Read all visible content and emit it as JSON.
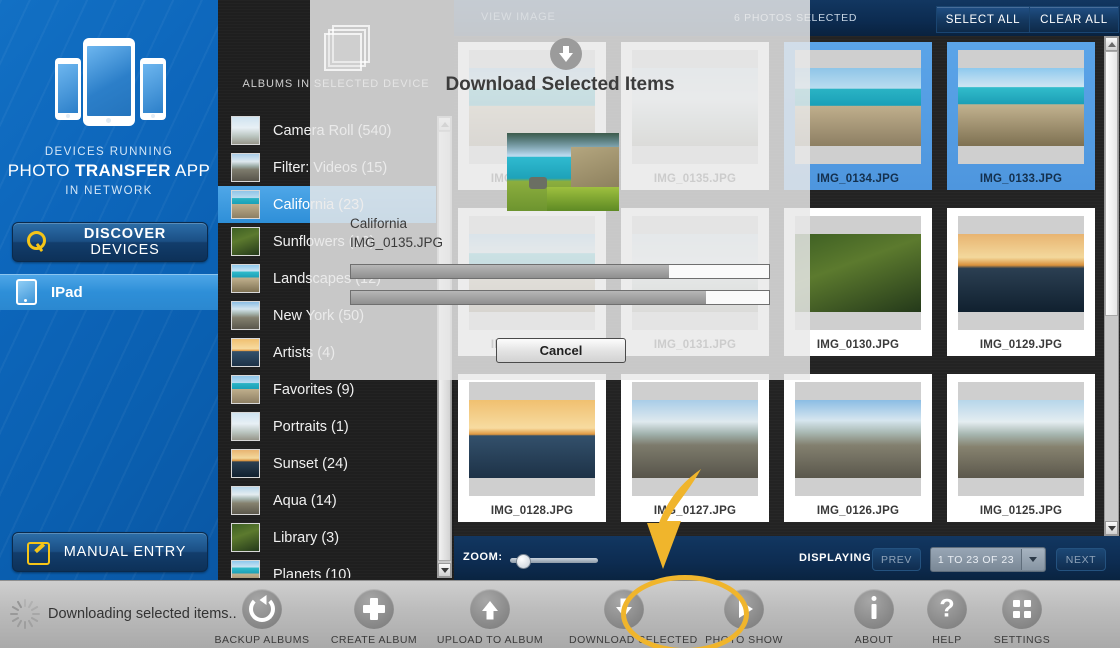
{
  "devices_panel": {
    "caption_line1": "DEVICES RUNNING",
    "caption_brand_a": "PHOTO ",
    "caption_brand_b": "TRANSFER",
    "caption_brand_c": " APP",
    "caption_line3": "IN NETWORK",
    "discover_label_a": "DISCOVER ",
    "discover_label_b": "DEVICES",
    "manual_label_a": "MANUAL ",
    "manual_label_b": "ENTRY",
    "device_name": "IPad"
  },
  "albums": {
    "header": "ALBUMS IN SELECTED DEVICE",
    "items": [
      {
        "label": "Camera Roll (540)",
        "selected": false
      },
      {
        "label": "Filter: Videos (15)",
        "selected": false
      },
      {
        "label": "California (23)",
        "selected": true
      },
      {
        "label": "Sunflowers (10)",
        "selected": false
      },
      {
        "label": "Landscapes (12)",
        "selected": false
      },
      {
        "label": "New York (50)",
        "selected": false
      },
      {
        "label": "Artists (4)",
        "selected": false
      },
      {
        "label": "Favorites (9)",
        "selected": false
      },
      {
        "label": "Portraits (1)",
        "selected": false
      },
      {
        "label": "Sunset (24)",
        "selected": false
      },
      {
        "label": "Aqua (14)",
        "selected": false
      },
      {
        "label": "Library (3)",
        "selected": false
      },
      {
        "label": "Planets (10)",
        "selected": false
      }
    ]
  },
  "photo_bar": {
    "view_image": "VIEW IMAGE",
    "photos_selected": "6 PHOTOS SELECTED",
    "select_all": "SELECT ALL",
    "clear_all": "CLEAR ALL"
  },
  "grid": {
    "photos": [
      {
        "name": "IMG_0136.JPG",
        "selected": false,
        "scene": "sc-coast1"
      },
      {
        "name": "IMG_0135.JPG",
        "selected": false,
        "scene": "sc-haze"
      },
      {
        "name": "IMG_0134.JPG",
        "selected": true,
        "scene": "sc-coast1"
      },
      {
        "name": "IMG_0133.JPG",
        "selected": true,
        "scene": "sc-coast2"
      },
      {
        "name": "IMG_0132.JPG",
        "selected": false,
        "scene": "sc-coast2"
      },
      {
        "name": "IMG_0131.JPG",
        "selected": false,
        "scene": "sc-haze"
      },
      {
        "name": "IMG_0130.JPG",
        "selected": false,
        "scene": "sc-flowers"
      },
      {
        "name": "IMG_0129.JPG",
        "selected": false,
        "scene": "sc-sunset2"
      },
      {
        "name": "IMG_0128.JPG",
        "selected": false,
        "scene": "sc-sunset1"
      },
      {
        "name": "IMG_0127.JPG",
        "selected": false,
        "scene": "sc-rocks1"
      },
      {
        "name": "IMG_0126.JPG",
        "selected": false,
        "scene": "sc-rocks2"
      },
      {
        "name": "IMG_0125.JPG",
        "selected": false,
        "scene": "sc-rocks3"
      }
    ]
  },
  "control_bar": {
    "zoom_label": "ZOOM:",
    "zoom_value": 8,
    "displaying_label": "DISPLAYING:",
    "prev": "PREV",
    "page_range": "1 TO 23 OF 23",
    "next": "NEXT"
  },
  "modal": {
    "title": "Download Selected Items",
    "album_name": "California",
    "file_name": "IMG_0135.JPG",
    "progress_overall_percent": 76,
    "progress_file_percent": 85,
    "cancel_label": "Cancel"
  },
  "toolbar": {
    "status_text": "Downloading selected items..",
    "items": [
      {
        "label": "BACKUP ALBUMS",
        "icon": "backup-icon"
      },
      {
        "label": "CREATE ALBUM",
        "icon": "plus-icon"
      },
      {
        "label": "UPLOAD TO ALBUM",
        "icon": "upload-icon"
      },
      {
        "label": "DOWNLOAD SELECTED",
        "icon": "download-icon"
      },
      {
        "label": "PHOTO SHOW",
        "icon": "play-icon"
      },
      {
        "label": "ABOUT",
        "icon": "info-icon"
      },
      {
        "label": "HELP",
        "icon": "question-icon"
      },
      {
        "label": "SETTINGS",
        "icon": "grid-icon"
      }
    ]
  },
  "colors": {
    "accent_blue": "#2e8fd8",
    "bar_blue": "#0d2c51",
    "highlight_yellow": "#f0b52c"
  }
}
